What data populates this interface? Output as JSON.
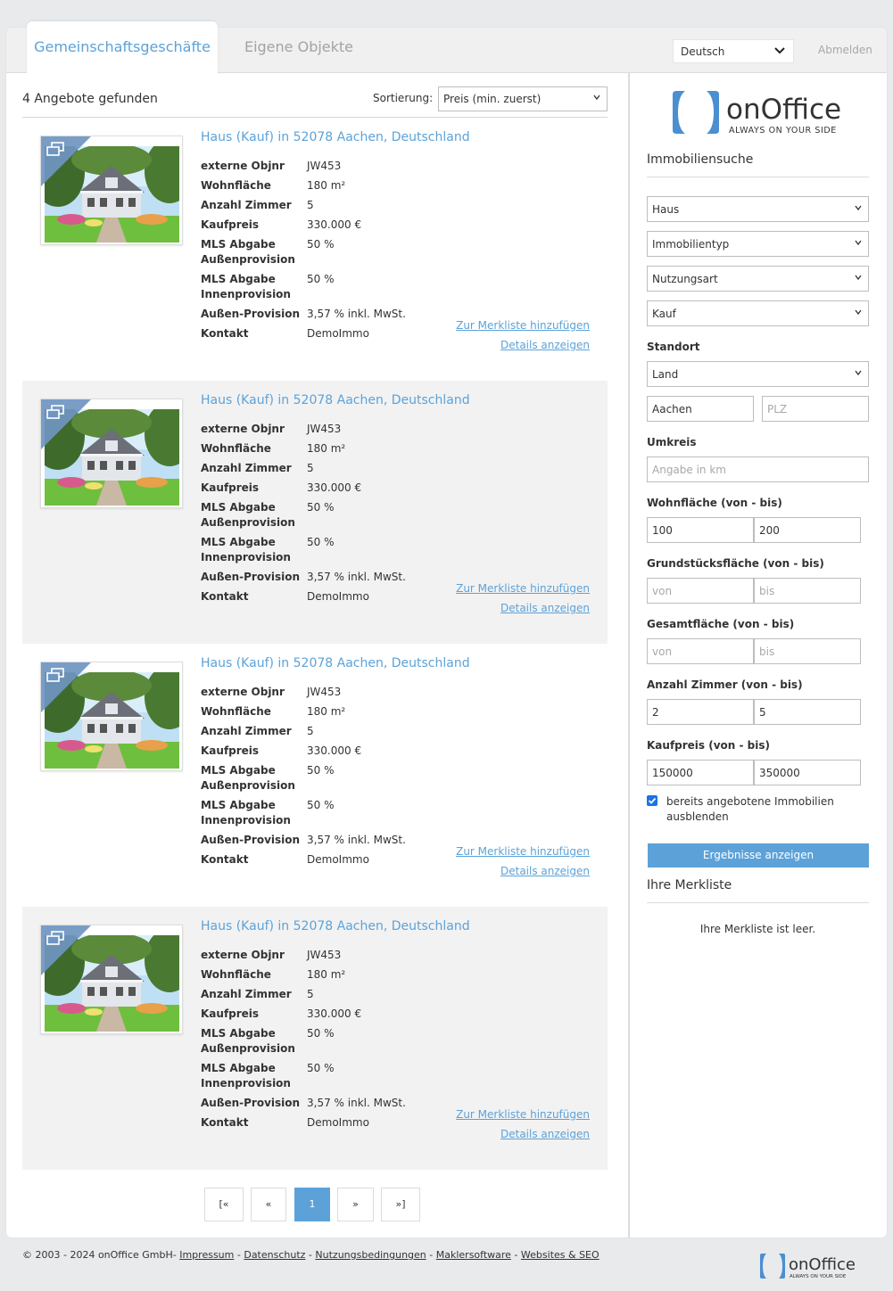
{
  "tabs": {
    "active": "Gemeinschaftsgeschäfte",
    "inactive": "Eigene Objekte"
  },
  "header": {
    "language": "Deutsch",
    "logout": "Abmelden"
  },
  "results_header": {
    "count_text": "4 Angebote gefunden",
    "sort_label": "Sortierung:",
    "sort_value": "Preis (min. zuerst)"
  },
  "results": [
    {
      "title": "Haus (Kauf) in 52078 Aachen, Deutschland",
      "fields": [
        {
          "k": "externe Objnr",
          "v": "JW453"
        },
        {
          "k": "Wohnfläche",
          "v": "180 m²"
        },
        {
          "k": "Anzahl Zimmer",
          "v": "5"
        },
        {
          "k": "Kaufpreis",
          "v": "330.000 €"
        },
        {
          "k": "MLS Abgabe Außenprovision",
          "v": "50 %"
        },
        {
          "k": "MLS Abgabe Innenprovision",
          "v": "50 %"
        },
        {
          "k": "Außen-Provision",
          "v": "3,57 % inkl. MwSt."
        },
        {
          "k": "Kontakt",
          "v": "DemoImmo"
        }
      ],
      "link_merkliste": "Zur Merkliste hinzufügen",
      "link_details": "Details anzeigen"
    },
    {
      "title": "Haus (Kauf) in 52078 Aachen, Deutschland",
      "fields": [
        {
          "k": "externe Objnr",
          "v": "JW453"
        },
        {
          "k": "Wohnfläche",
          "v": "180 m²"
        },
        {
          "k": "Anzahl Zimmer",
          "v": "5"
        },
        {
          "k": "Kaufpreis",
          "v": "330.000 €"
        },
        {
          "k": "MLS Abgabe Außenprovision",
          "v": "50 %"
        },
        {
          "k": "MLS Abgabe Innenprovision",
          "v": "50 %"
        },
        {
          "k": "Außen-Provision",
          "v": "3,57 % inkl. MwSt."
        },
        {
          "k": "Kontakt",
          "v": "DemoImmo"
        }
      ],
      "link_merkliste": "Zur Merkliste hinzufügen",
      "link_details": "Details anzeigen"
    },
    {
      "title": "Haus (Kauf) in 52078 Aachen, Deutschland",
      "fields": [
        {
          "k": "externe Objnr",
          "v": "JW453"
        },
        {
          "k": "Wohnfläche",
          "v": "180 m²"
        },
        {
          "k": "Anzahl Zimmer",
          "v": "5"
        },
        {
          "k": "Kaufpreis",
          "v": "330.000 €"
        },
        {
          "k": "MLS Abgabe Außenprovision",
          "v": "50 %"
        },
        {
          "k": "MLS Abgabe Innenprovision",
          "v": "50 %"
        },
        {
          "k": "Außen-Provision",
          "v": "3,57 % inkl. MwSt."
        },
        {
          "k": "Kontakt",
          "v": "DemoImmo"
        }
      ],
      "link_merkliste": "Zur Merkliste hinzufügen",
      "link_details": "Details anzeigen"
    },
    {
      "title": "Haus (Kauf) in 52078 Aachen, Deutschland",
      "fields": [
        {
          "k": "externe Objnr",
          "v": "JW453"
        },
        {
          "k": "Wohnfläche",
          "v": "180 m²"
        },
        {
          "k": "Anzahl Zimmer",
          "v": "5"
        },
        {
          "k": "Kaufpreis",
          "v": "330.000 €"
        },
        {
          "k": "MLS Abgabe Außenprovision",
          "v": "50 %"
        },
        {
          "k": "MLS Abgabe Innenprovision",
          "v": "50 %"
        },
        {
          "k": "Außen-Provision",
          "v": "3,57 % inkl. MwSt."
        },
        {
          "k": "Kontakt",
          "v": "DemoImmo"
        }
      ],
      "link_merkliste": "Zur Merkliste hinzufügen",
      "link_details": "Details anzeigen"
    }
  ],
  "pagination": [
    "[«",
    "«",
    "1",
    "»",
    "»]"
  ],
  "sidebar": {
    "logo_text": "onOffice",
    "logo_tagline": "ALWAYS ON YOUR SIDE",
    "search_title": "Immobiliensuche",
    "select_objektart": "Haus",
    "select_typ": "Immobilientyp",
    "select_nutzung": "Nutzungsart",
    "select_vermarktung": "Kauf",
    "standort_label": "Standort",
    "select_land": "Land",
    "ort_value": "Aachen",
    "plz_placeholder": "PLZ",
    "umkreis_label": "Umkreis",
    "umkreis_placeholder": "Angabe in km",
    "wohnflaeche_label": "Wohnfläche (von - bis)",
    "wohnflaeche_von": "100",
    "wohnflaeche_bis": "200",
    "grundstueck_label": "Grundstücksfläche (von - bis)",
    "gesamt_label": "Gesamtfläche (von - bis)",
    "placeholder_von": "von",
    "placeholder_bis": "bis",
    "zimmer_label": "Anzahl Zimmer (von - bis)",
    "zimmer_von": "2",
    "zimmer_bis": "5",
    "kaufpreis_label": "Kaufpreis (von - bis)",
    "kaufpreis_von": "150000",
    "kaufpreis_bis": "350000",
    "checkbox_label": "bereits angebotene Immobilien ausblenden",
    "submit": "Ergebnisse anzeigen",
    "merkliste_title": "Ihre Merkliste",
    "merkliste_empty": "Ihre Merkliste ist leer."
  },
  "footer": {
    "copyright": "© 2003 - 2024 onOffice GmbH-",
    "links": [
      "Impressum",
      "Datenschutz",
      "Nutzungsbedingungen",
      "Maklersoftware",
      "Websites & SEO"
    ],
    "sep": "-"
  },
  "colors": {
    "accent": "#5ca2d8",
    "corner": "#6f95c1",
    "alt_row": "#f2f2f2"
  },
  "icons": [
    "chevron-down-icon",
    "gallery-icon",
    "house-photo",
    "onoffice-logo",
    "checkbox-checked-icon"
  ]
}
